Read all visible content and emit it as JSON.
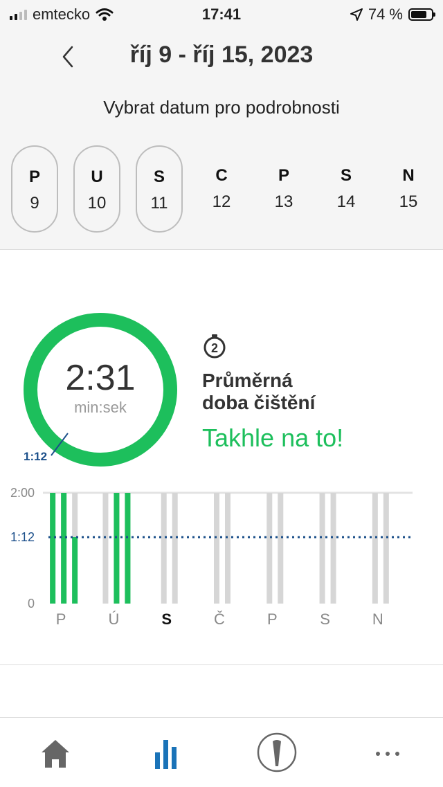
{
  "status_bar": {
    "carrier": "emtecko",
    "time": "17:41",
    "battery": "74 %",
    "icons": [
      "signal-icon",
      "wifi-icon",
      "location-arrow-icon",
      "battery-icon"
    ]
  },
  "header": {
    "week_title": "říj 9 - říj 15, 2023",
    "subtitle": "Vybrat datum pro podrobnosti",
    "days": [
      {
        "letter": "P",
        "num": "9",
        "has_data": true
      },
      {
        "letter": "U",
        "num": "10",
        "has_data": true
      },
      {
        "letter": "S",
        "num": "11",
        "has_data": true
      },
      {
        "letter": "C",
        "num": "12",
        "has_data": false
      },
      {
        "letter": "P",
        "num": "13",
        "has_data": false
      },
      {
        "letter": "S",
        "num": "14",
        "has_data": false
      },
      {
        "letter": "N",
        "num": "15",
        "has_data": false
      }
    ]
  },
  "summary": {
    "time": "2:31",
    "unit": "min:sek",
    "target_label": "1:12",
    "timer_badge": "2",
    "avg_label_line1": "Průměrná",
    "avg_label_line2": "doba čištění",
    "praise": "Takhle na to!"
  },
  "chart_data": {
    "type": "bar",
    "y_ticks": [
      "2:00",
      "1:12",
      "0"
    ],
    "ylim_seconds": [
      0,
      120
    ],
    "target_seconds": 72,
    "categories": [
      "P",
      "Ú",
      "S",
      "Č",
      "P",
      "S",
      "N"
    ],
    "highlighted_category": "S",
    "sessions_seconds": [
      [
        120,
        120,
        72
      ],
      [
        0,
        120,
        120
      ],
      [
        0,
        0
      ],
      [
        0,
        0
      ],
      [
        0,
        0
      ],
      [
        0,
        0
      ],
      [
        0,
        0
      ]
    ]
  },
  "colors": {
    "accent_green": "#1dbf5c",
    "target_blue": "#1b4f8a",
    "bar_empty": "#d6d6d6",
    "active_tab_blue": "#1a73b8"
  },
  "tabs": [
    {
      "name": "home-icon"
    },
    {
      "name": "stats-icon"
    },
    {
      "name": "toothbrush-icon"
    },
    {
      "name": "more-icon"
    }
  ]
}
